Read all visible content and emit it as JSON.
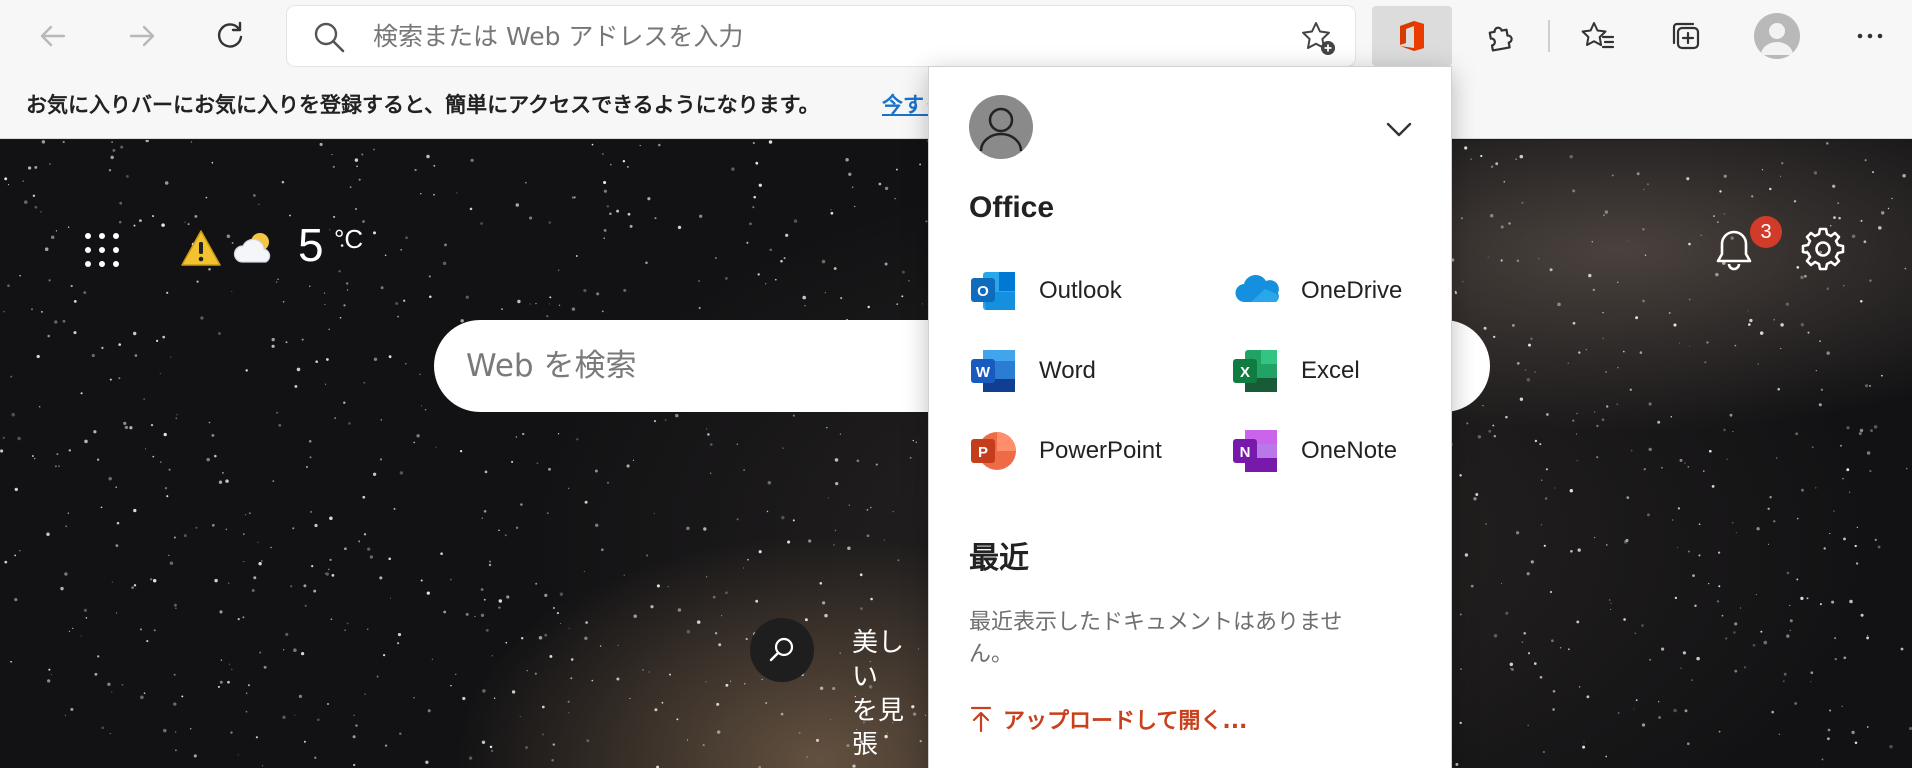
{
  "toolbar": {
    "address_placeholder": "検索または Web アドレスを入力",
    "icons": [
      "back-icon",
      "forward-icon",
      "refresh-icon",
      "search-icon",
      "add-favorite-icon",
      "office-icon",
      "extensions-icon",
      "favorites-icon",
      "collections-icon",
      "profile-icon",
      "more-icon"
    ]
  },
  "favorites_bar": {
    "message": "お気に入りバーにお気に入りを登録すると、簡単にアクセスできるようになります。",
    "link": "今すぐ"
  },
  "newtab": {
    "weather": {
      "temp": "5",
      "unit": "°C",
      "icons": [
        "warning-icon",
        "partly-cloudy-icon"
      ]
    },
    "notification_count": "3",
    "web_search_placeholder": "Web を検索",
    "bottom_text": "美しい\nを見張"
  },
  "office_panel": {
    "title": "Office",
    "apps": [
      {
        "label": "Outlook",
        "color": "#0f6cbd"
      },
      {
        "label": "OneDrive",
        "color": "#1490df"
      },
      {
        "label": "Word",
        "color": "#185abd"
      },
      {
        "label": "Excel",
        "color": "#107c41"
      },
      {
        "label": "PowerPoint",
        "color": "#c43e1c"
      },
      {
        "label": "OneNote",
        "color": "#7719aa"
      }
    ],
    "recent_title": "最近",
    "recent_empty_line1": "最近表示したドキュメントはありませ",
    "recent_empty_line2": "ん。",
    "upload_label": "アップロードして開く..."
  },
  "colors": {
    "accent_link": "#1a73c8",
    "upload": "#c8401d",
    "badge": "#d13b2a"
  }
}
